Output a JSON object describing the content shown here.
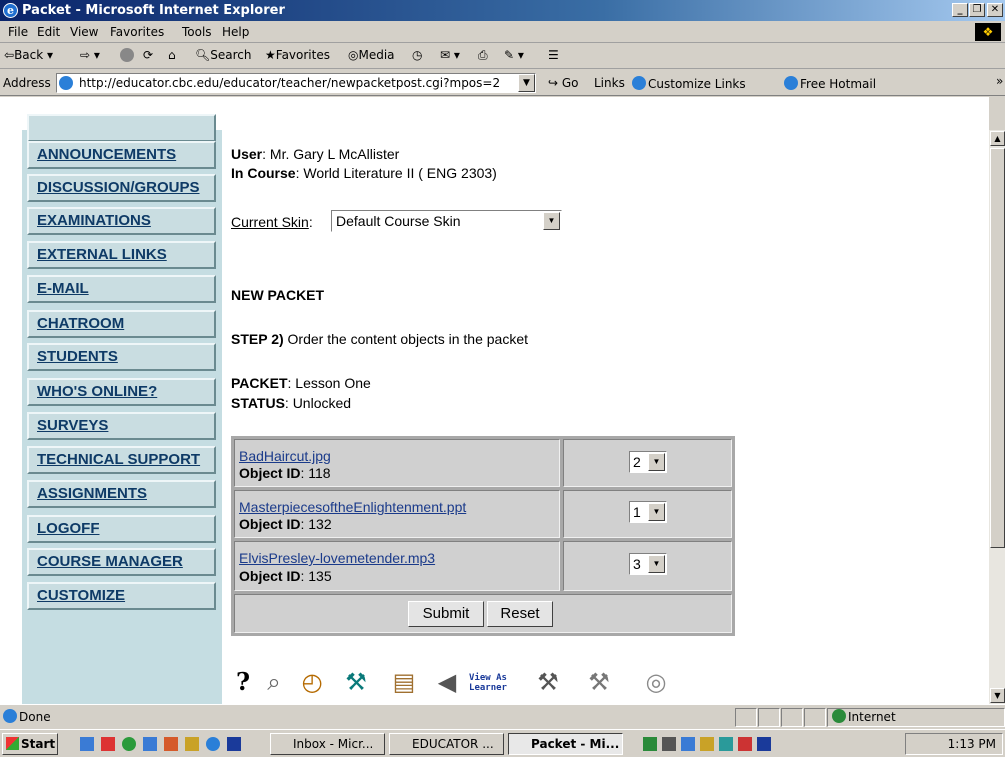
{
  "window": {
    "title": "Packet - Microsoft Internet Explorer"
  },
  "menu": [
    "File",
    "Edit",
    "View",
    "Favorites",
    "Tools",
    "Help"
  ],
  "toolbar": {
    "back": "Back",
    "search": "Search",
    "favorites": "Favorites",
    "media": "Media"
  },
  "address": {
    "label": "Address",
    "url": "http://educator.cbc.edu/educator/teacher/newpacketpost.cgi?mpos=2",
    "go": "Go",
    "links": "Links",
    "customize": "Customize Links",
    "hotmail": "Free Hotmail"
  },
  "sidebar": {
    "items": [
      "ANNOUNCEMENTS",
      "DISCUSSION/GROUPS",
      "EXAMINATIONS",
      "EXTERNAL LINKS",
      "E-MAIL",
      "CHATROOM",
      "STUDENTS",
      "WHO'S ONLINE?",
      "SURVEYS",
      "TECHNICAL SUPPORT",
      "ASSIGNMENTS",
      "LOGOFF",
      "COURSE MANAGER",
      "CUSTOMIZE"
    ]
  },
  "main": {
    "user_label": "User",
    "user_value": ": Mr. Gary L McAllister",
    "course_label": "In Course",
    "course_value": ": World Literature II ( ENG 2303)",
    "skin_label": "Current Skin",
    "skin_colon": ":",
    "skin_value": "Default Course Skin",
    "heading": "NEW PACKET",
    "step_label": "STEP 2)",
    "step_text": " Order the content objects in the packet",
    "packet_label": "PACKET",
    "packet_value": ": Lesson One",
    "status_label": "STATUS",
    "status_value": ": Unlocked",
    "objects": [
      {
        "name": "BadHaircut.jpg",
        "id_label": "Object ID",
        "id_value": ": 118",
        "order": "2"
      },
      {
        "name": "MasterpiecesoftheEnlightenment.ppt",
        "id_label": "Object ID",
        "id_value": ": 132",
        "order": "1"
      },
      {
        "name": "ElvisPresley-lovemetender.mp3",
        "id_label": "Object ID",
        "id_value": ": 135",
        "order": "3"
      }
    ],
    "submit": "Submit",
    "reset": "Reset",
    "view_as_learner": "View As Learner"
  },
  "statusbar": {
    "text": "Done",
    "zone": "Internet"
  },
  "taskbar": {
    "start": "Start",
    "tasks": [
      "Inbox - Micr...",
      "EDUCATOR ...",
      "Packet - Mi..."
    ],
    "clock": "1:13 PM"
  }
}
